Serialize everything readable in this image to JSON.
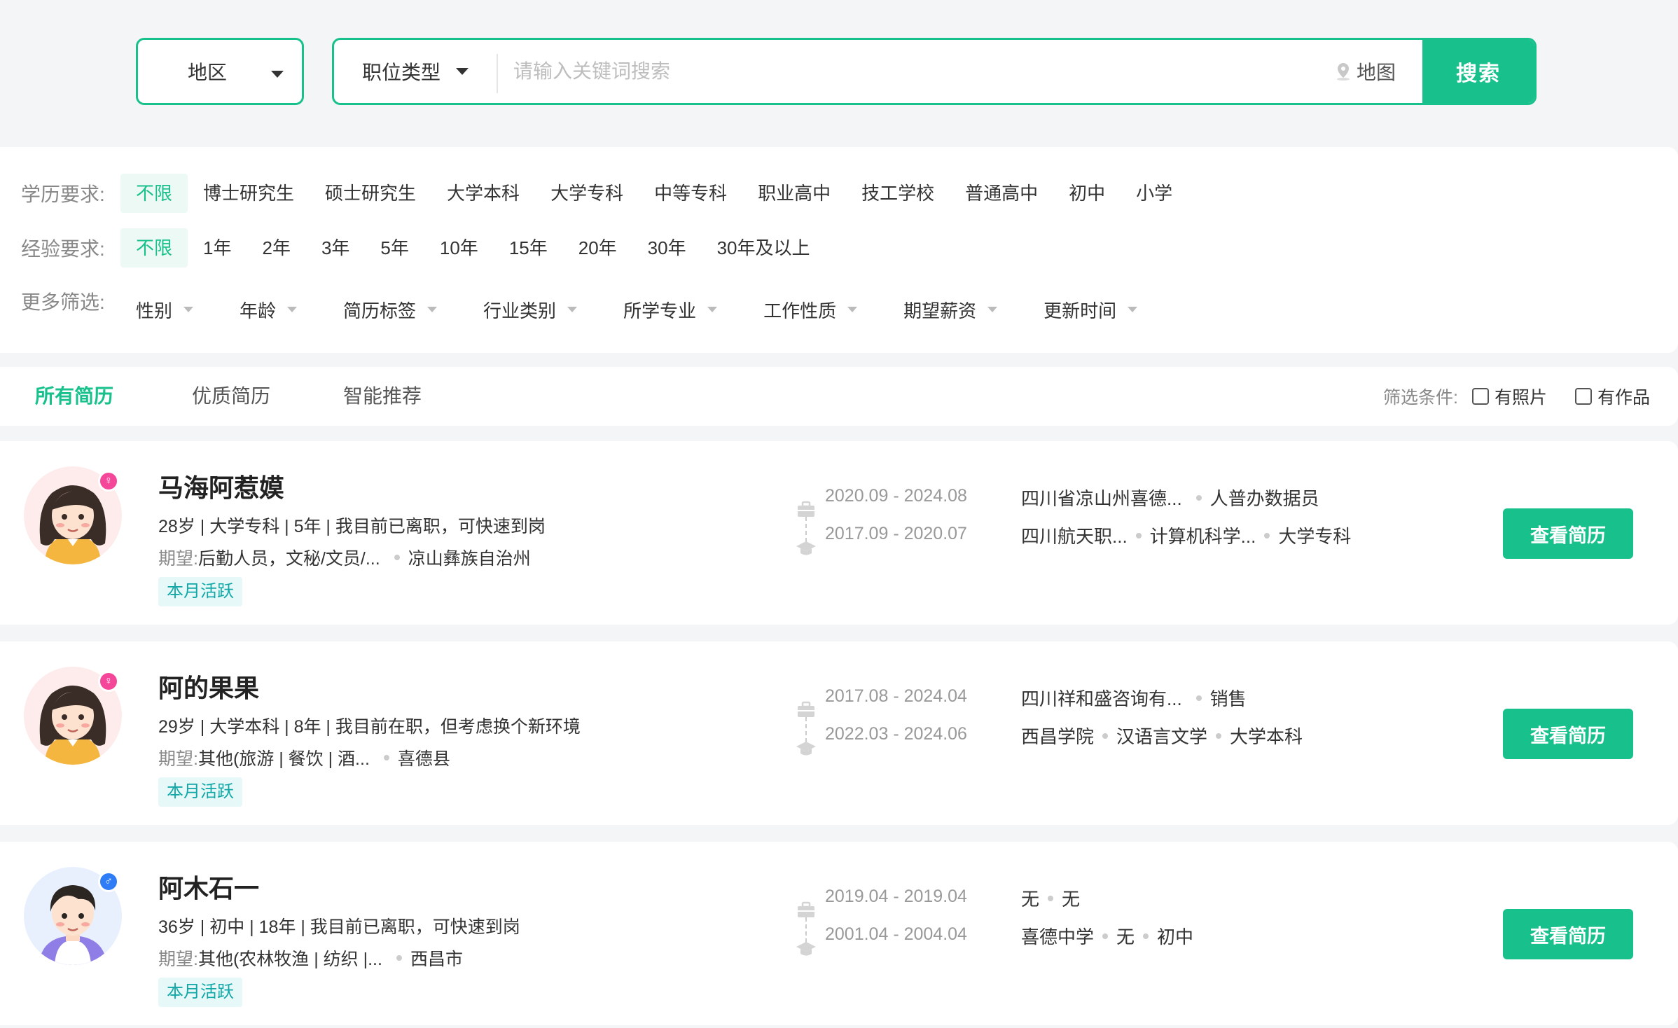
{
  "search": {
    "region_label": "地区",
    "job_type_label": "职位类型",
    "keyword_placeholder": "请输入关键词搜索",
    "map_label": "地图",
    "search_button": "搜索"
  },
  "filters": {
    "education": {
      "label": "学历要求:",
      "options": [
        "不限",
        "博士研究生",
        "硕士研究生",
        "大学本科",
        "大学专科",
        "中等专科",
        "职业高中",
        "技工学校",
        "普通高中",
        "初中",
        "小学"
      ],
      "selected": "不限"
    },
    "experience": {
      "label": "经验要求:",
      "options": [
        "不限",
        "1年",
        "2年",
        "3年",
        "5年",
        "10年",
        "15年",
        "20年",
        "30年",
        "30年及以上"
      ],
      "selected": "不限"
    },
    "more": {
      "label": "更多筛选:",
      "dropdowns": [
        "性别",
        "年龄",
        "简历标签",
        "行业类别",
        "所学专业",
        "工作性质",
        "期望薪资",
        "更新时间"
      ]
    }
  },
  "tabs": {
    "items": [
      "所有简历",
      "优质简历",
      "智能推荐"
    ],
    "active": "所有简历",
    "condition_label": "筛选条件:",
    "checkbox_photo": "有照片",
    "checkbox_works": "有作品"
  },
  "resumes": [
    {
      "name": "马海阿惹嫫",
      "gender": "female",
      "meta": "28岁 | 大学专科 | 5年 | 我目前已离职，可快速到岗",
      "expect_label": "期望:",
      "expect_job": "后勤人员，文秘/文员/...",
      "expect_place": "凉山彝族自治州",
      "tag": "本月活跃",
      "work_dates": "2020.09 - 2024.08",
      "work_company": "四川省凉山州喜德...",
      "work_position": "人普办数据员",
      "edu_dates": "2017.09 - 2020.07",
      "edu_school": "四川航天职...",
      "edu_major": "计算机科学...",
      "edu_degree": "大学专科",
      "button": "查看简历"
    },
    {
      "name": "阿的果果",
      "gender": "female",
      "meta": "29岁 | 大学本科 | 8年 | 我目前在职，但考虑换个新环境",
      "expect_label": "期望:",
      "expect_job": "其他(旅游 | 餐饮 | 酒...",
      "expect_place": "喜德县",
      "tag": "本月活跃",
      "work_dates": "2017.08 - 2024.04",
      "work_company": "四川祥和盛咨询有...",
      "work_position": "销售",
      "edu_dates": "2022.03 - 2024.06",
      "edu_school": "西昌学院",
      "edu_major": "汉语言文学",
      "edu_degree": "大学本科",
      "button": "查看简历"
    },
    {
      "name": "阿木石一",
      "gender": "male",
      "meta": "36岁 | 初中 | 18年 | 我目前已离职，可快速到岗",
      "expect_label": "期望:",
      "expect_job": "其他(农林牧渔 | 纺织 |...",
      "expect_place": "西昌市",
      "tag": "本月活跃",
      "work_dates": "2019.04 - 2019.04",
      "work_company": "无",
      "work_position": "无",
      "edu_dates": "2001.04 - 2004.04",
      "edu_school": "喜德中学",
      "edu_major": "无",
      "edu_degree": "初中",
      "button": "查看简历"
    }
  ],
  "colors": {
    "accent": "#18c18b",
    "tag_bg": "#e7f8f8",
    "tag_text": "#12a7a7",
    "female": "#f5479a",
    "male": "#2f7df6"
  }
}
